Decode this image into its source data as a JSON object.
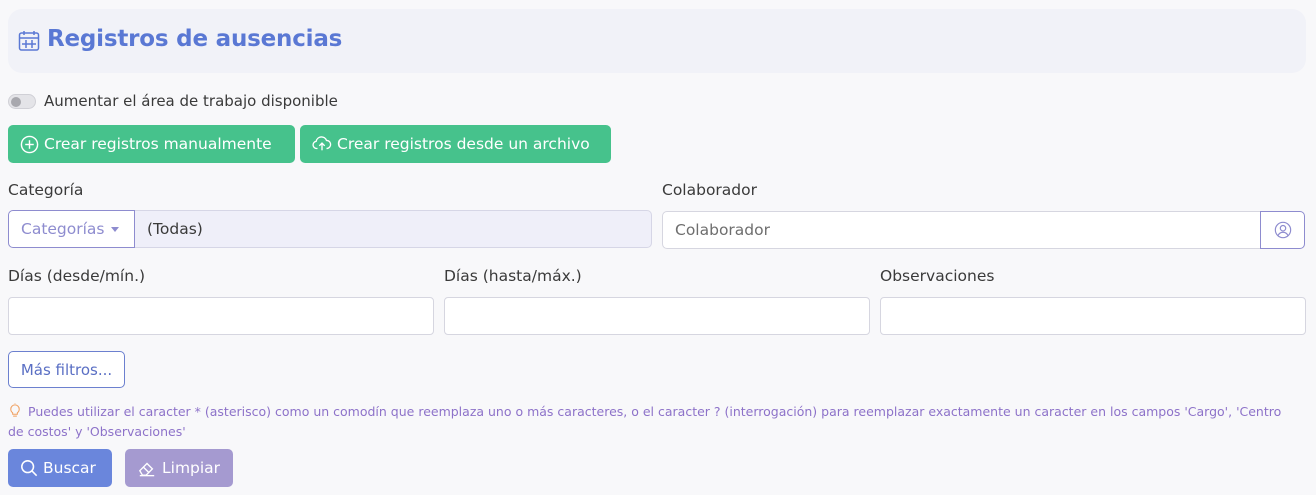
{
  "header": {
    "title": "Registros de ausencias",
    "icon": "calendar-icon"
  },
  "toggle": {
    "label": "Aumentar el área de trabajo disponible",
    "on": false
  },
  "actions": {
    "manual_label": "Crear registros manualmente",
    "file_label": "Crear registros desde un archivo",
    "color": "#46c28c"
  },
  "filters": {
    "categoria": {
      "label": "Categoría",
      "dropdown_label": "Categorías",
      "value": "(Todas)"
    },
    "colaborador": {
      "label": "Colaborador",
      "placeholder": "Colaborador"
    },
    "dias_desde": {
      "label": "Días (desde/mín.)",
      "value": ""
    },
    "dias_hasta": {
      "label": "Días (hasta/máx.)",
      "value": ""
    },
    "observaciones": {
      "label": "Observaciones",
      "value": ""
    },
    "more_label": "Más filtros..."
  },
  "hint": "Puedes utilizar el caracter * (asterisco) como un comodín que reemplaza uno o más caracteres, o el caracter ? (interrogación) para reemplazar exactamente un caracter en los campos 'Cargo', 'Centro de costos' y 'Observaciones'",
  "buttons": {
    "search_label": "Buscar",
    "clear_label": "Limpiar"
  }
}
